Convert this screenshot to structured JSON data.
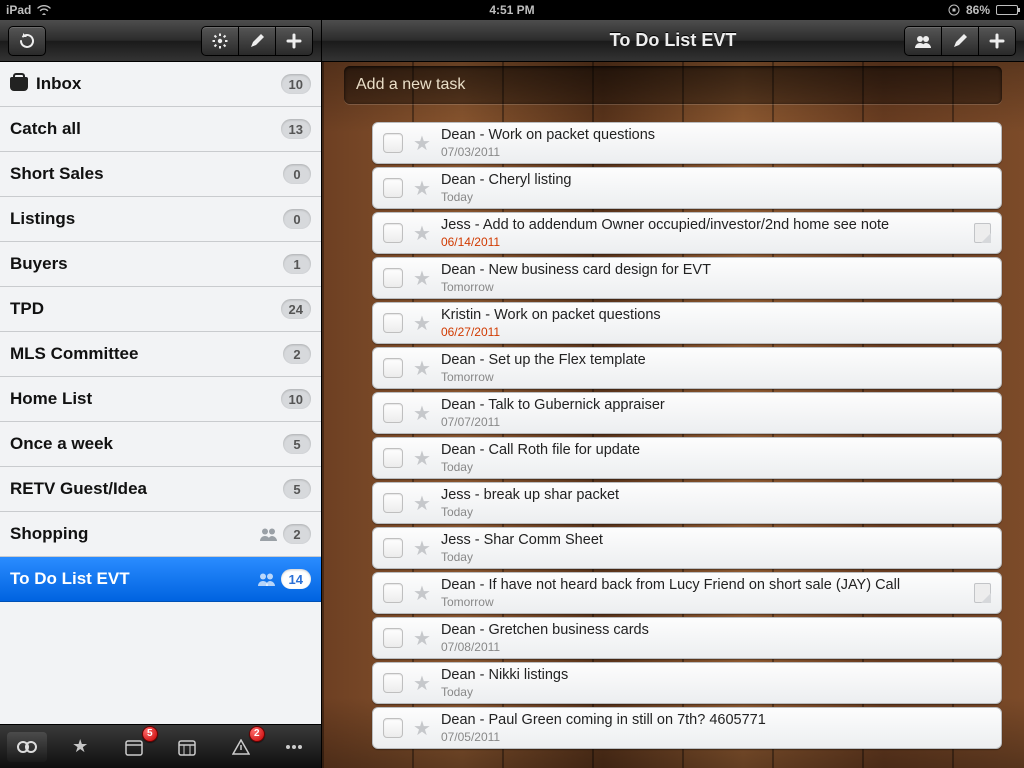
{
  "statusbar": {
    "device": "iPad",
    "time": "4:51 PM",
    "battery_pct": "86%",
    "battery_level": 86
  },
  "sidebar": {
    "items": [
      {
        "label": "Inbox",
        "count": "10",
        "icon": "inbox"
      },
      {
        "label": "Catch all",
        "count": "13"
      },
      {
        "label": "Short Sales",
        "count": "0"
      },
      {
        "label": "Listings",
        "count": "0"
      },
      {
        "label": "Buyers",
        "count": "1"
      },
      {
        "label": "TPD",
        "count": "24"
      },
      {
        "label": "MLS Committee",
        "count": "2"
      },
      {
        "label": "Home List",
        "count": "10"
      },
      {
        "label": "Once a week",
        "count": "5"
      },
      {
        "label": "RETV Guest/Idea",
        "count": "5"
      },
      {
        "label": "Shopping",
        "count": "2",
        "shared": true
      },
      {
        "label": "To Do List EVT",
        "count": "14",
        "shared": true,
        "selected": true
      }
    ],
    "tabbar_badges": {
      "calendar1": "5",
      "alert": "2"
    }
  },
  "main": {
    "title": "To Do List EVT",
    "addtask_placeholder": "Add a new task",
    "tasks": [
      {
        "title": "Dean - Work on packet questions",
        "date": "07/03/2011"
      },
      {
        "title": "Dean - Cheryl listing",
        "date": "Today"
      },
      {
        "title": "Jess - Add to addendum Owner occupied/investor/2nd home see note",
        "date": "06/14/2011",
        "overdue": true,
        "note": true
      },
      {
        "title": "Dean - New business card design for EVT",
        "date": "Tomorrow"
      },
      {
        "title": "Kristin - Work on packet questions",
        "date": "06/27/2011",
        "overdue": true
      },
      {
        "title": "Dean - Set up the Flex template",
        "date": "Tomorrow"
      },
      {
        "title": "Dean - Talk to Gubernick appraiser",
        "date": "07/07/2011"
      },
      {
        "title": "Dean - Call Roth file for update",
        "date": "Today"
      },
      {
        "title": "Jess - break up shar packet",
        "date": "Today"
      },
      {
        "title": "Jess - Shar Comm Sheet",
        "date": "Today"
      },
      {
        "title": "Dean - If have not heard back from Lucy Friend on short sale (JAY) Call",
        "date": "Tomorrow",
        "note": true
      },
      {
        "title": "Dean - Gretchen business cards",
        "date": "07/08/2011"
      },
      {
        "title": "Dean - Nikki listings",
        "date": "Today"
      },
      {
        "title": "Dean - Paul Green coming in still on 7th? 4605771",
        "date": "07/05/2011"
      }
    ]
  }
}
